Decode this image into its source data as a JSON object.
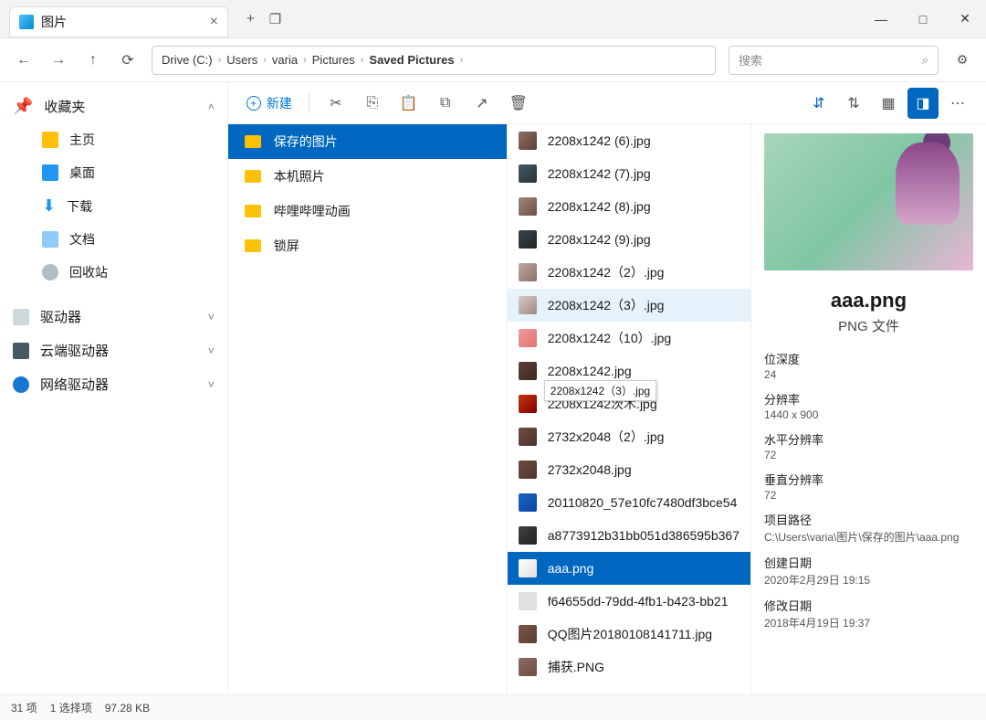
{
  "tab": {
    "title": "图片"
  },
  "window": {
    "minimize": "—",
    "maximize": "□",
    "close": "✕"
  },
  "nav": {
    "back": "←",
    "forward": "→",
    "up": "↑",
    "refresh": "⟳"
  },
  "breadcrumb": [
    "Drive (C:)",
    "Users",
    "varia",
    "Pictures",
    "Saved Pictures"
  ],
  "search": {
    "placeholder": "搜索"
  },
  "sidebar": {
    "favorites": {
      "label": "收藏夹",
      "items": [
        "主页",
        "桌面",
        "下载",
        "文档",
        "回收站"
      ]
    },
    "drives": {
      "label": "驱动器"
    },
    "cloud": {
      "label": "云端驱动器"
    },
    "network": {
      "label": "网络驱动器"
    }
  },
  "toolbar": {
    "new": "新建"
  },
  "folders": [
    "保存的图片",
    "本机照片",
    "哔哩哔哩动画",
    "锁屏"
  ],
  "files": [
    "2208x1242 (6).jpg",
    "2208x1242 (7).jpg",
    "2208x1242 (8).jpg",
    "2208x1242 (9).jpg",
    "2208x1242（2）.jpg",
    "2208x1242（3）.jpg",
    "2208x1242（10）.jpg",
    "2208x1242.jpg",
    "2208x1242茨木.jpg",
    "2732x2048（2）.jpg",
    "2732x2048.jpg",
    "20110820_57e10fc7480df3bce54",
    "a8773912b31bb051d386595b367",
    "aaa.png",
    "f64655dd-79dd-4fb1-b423-bb21",
    "QQ图片20180108141711.jpg",
    "捕获.PNG"
  ],
  "tooltip": "2208x1242（3）.jpg",
  "details": {
    "title": "aaa.png",
    "type": "PNG 文件",
    "fields": [
      {
        "label": "位深度",
        "value": "24"
      },
      {
        "label": "分辨率",
        "value": "1440 x 900"
      },
      {
        "label": "水平分辨率",
        "value": "72"
      },
      {
        "label": "垂直分辨率",
        "value": "72"
      },
      {
        "label": "项目路径",
        "value": "C:\\Users\\varia\\图片\\保存的图片\\aaa.png"
      },
      {
        "label": "创建日期",
        "value": "2020年2月29日 19:15"
      },
      {
        "label": "修改日期",
        "value": "2018年4月19日 19:37"
      }
    ]
  },
  "status": {
    "count": "31 项",
    "selection": "1 选择项",
    "size": "97.28 KB"
  }
}
